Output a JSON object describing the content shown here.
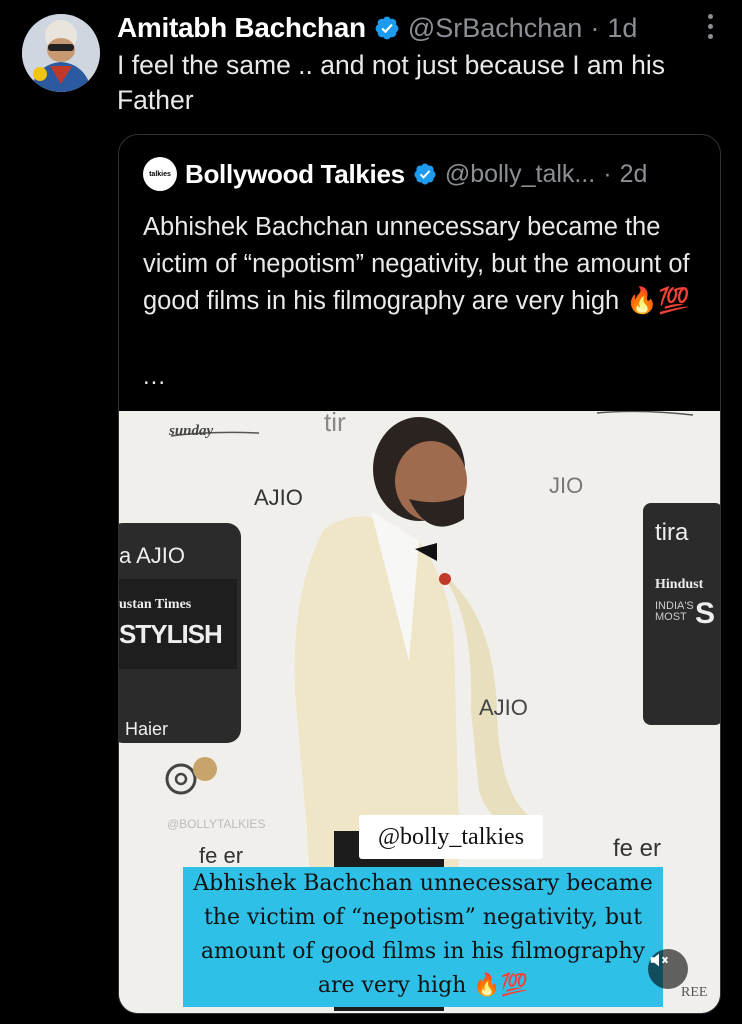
{
  "tweet": {
    "author_name": "Amitabh Bachchan",
    "handle": "@SrBachchan",
    "dot": "·",
    "time": "1d",
    "text": "I feel the same .. and not just because I am his Father"
  },
  "quoted_tweet": {
    "author_name": "Bollywood Talkies",
    "handle": "@bolly_talk...",
    "dot": "·",
    "time": "2d",
    "text": "Abhishek Bachchan unnecessary became the victim of “nepotism” negativity, but the amount of good films in his filmography are very high 🔥💯",
    "ellipsis": "...",
    "avatar_text": "talkies"
  },
  "media": {
    "watermark": "@bolly_talkies",
    "caption": "Abhishek Bachchan unnecessary became the victim of “nepotism” negativity, but amount of good films in his filmography are very high 🔥💯",
    "backdrop_labels": {
      "ajio1": "AJIO",
      "ajio2": "JIO",
      "ajio3": "a AJIO",
      "ajio4": "AJIO",
      "tira1": "tir",
      "tira2": "tira",
      "ht1": "ustan Times",
      "ht2": "Hindust",
      "stylish": "STYLISH",
      "indias_most": "INDIA'S MOST",
      "st": "S",
      "sunday": "sunday",
      "haier": "Haier",
      "feer1": "fe er",
      "feer2": "fe er",
      "bollytalkies": "@BOLLYTALKIES",
      "ree": "REE"
    }
  },
  "colors": {
    "verified": "#1d9bf0",
    "caption_bg": "#2fc0e8"
  },
  "icons": [
    "verified-badge-icon",
    "more-options-icon",
    "mute-icon",
    "instagram-icon"
  ]
}
